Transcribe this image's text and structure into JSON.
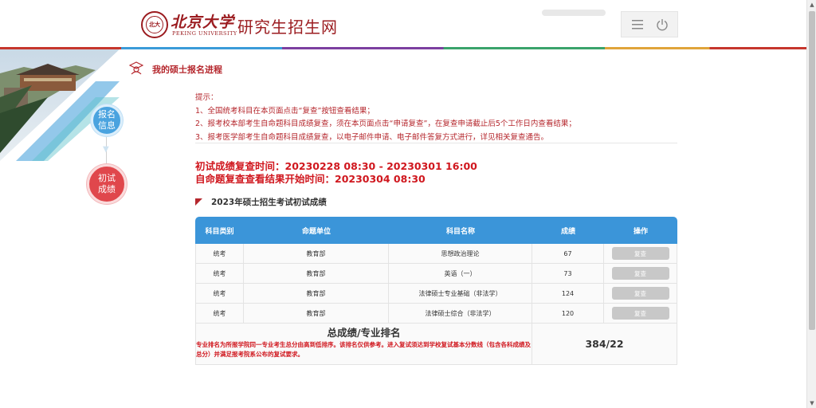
{
  "header": {
    "logo_cn": "北京大学",
    "logo_en": "PEKING UNIVERSITY",
    "logo_seal_char": "北大",
    "site_title": "研究生招生网",
    "menu_icon": "menu-icon",
    "power_icon": "power-icon"
  },
  "steps": [
    {
      "label_line1": "报名",
      "label_line2": "信息",
      "color": "#4aa3df"
    },
    {
      "label_line1": "初试",
      "label_line2": "成绩",
      "color": "#e0474c"
    }
  ],
  "page_heading": "我的硕士报名进程",
  "notes": {
    "title": "提示：",
    "items": [
      "1、全国统考科目在本页面点击“复查”按钮查看结果；",
      "2、报考校本部考生自命题科目成绩复查，须在本页面点击“申请复查”，在复查申请截止后5个工作日内查看结果；",
      "3、报考医学部考生自命题科目成绩复查，以电子邮件申请、电子邮件答复方式进行，详见相关复查通告。"
    ]
  },
  "times": {
    "line1": "初试成绩复查时间：20230228 08:30 - 20230301 16:00",
    "line2": "自命题复查查看结果开始时间：20230304 08:30"
  },
  "section_title": "2023年硕士招生考试初试成绩",
  "table": {
    "headers": [
      "科目类别",
      "命题单位",
      "科目名称",
      "成绩",
      "操作"
    ],
    "rows": [
      {
        "type": "统考",
        "unit": "教育部",
        "subject": "思想政治理论",
        "score": "67",
        "action": "复查"
      },
      {
        "type": "统考",
        "unit": "教育部",
        "subject": "英语（一）",
        "score": "73",
        "action": "复查"
      },
      {
        "type": "统考",
        "unit": "教育部",
        "subject": "法律硕士专业基础（非法学）",
        "score": "124",
        "action": "复查"
      },
      {
        "type": "统考",
        "unit": "教育部",
        "subject": "法律硕士综合（非法学）",
        "score": "120",
        "action": "复查"
      }
    ],
    "total_title": "总成绩/专业排名",
    "total_note": "专业排名为所报学院同一专业考生总分由高到低排序。该排名仅供参考。进入复试须达到学校复试基本分数线（包含各科成绩及总分）并满足报考院系公布的复试要求。",
    "total_value": "384/22"
  },
  "colors": {
    "brand_red": "#9b1b1f",
    "accent_red": "#d0171e",
    "table_header": "#3b95d9"
  }
}
